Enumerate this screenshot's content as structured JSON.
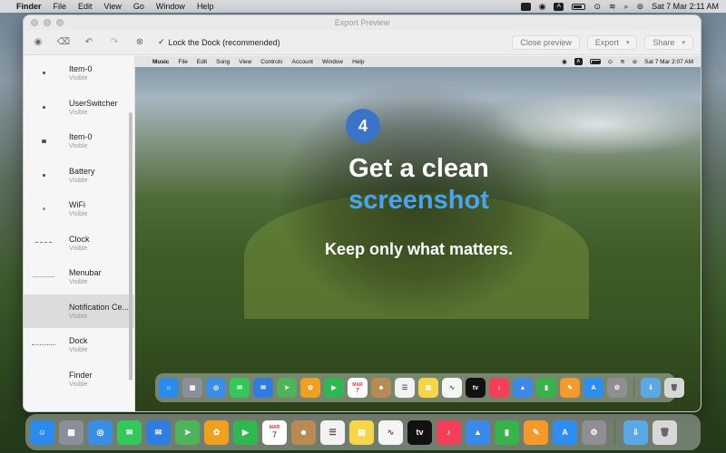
{
  "menubar": {
    "app_name": "Finder",
    "items": [
      "File",
      "Edit",
      "View",
      "Go",
      "Window",
      "Help"
    ],
    "clock": "Sat 7 Mar  2:11 AM",
    "status_a": "A"
  },
  "window": {
    "title": "Export Preview",
    "toolbar": {
      "checkbox_label": "Lock the Dock (recommended)",
      "close_preview": "Close preview",
      "export": "Export",
      "share": "Share"
    }
  },
  "sidebar": {
    "items": [
      {
        "name": "Item-0",
        "status": "Visible",
        "thumb": "dot"
      },
      {
        "name": "UserSwitcher",
        "status": "Visible",
        "thumb": "dot"
      },
      {
        "name": "Item-0",
        "status": "Visible",
        "thumb": "dot"
      },
      {
        "name": "Battery",
        "status": "Visible",
        "thumb": "dot"
      },
      {
        "name": "WiFi",
        "status": "Visible",
        "thumb": "dot"
      },
      {
        "name": "Clock",
        "status": "Visible",
        "thumb": "dash"
      },
      {
        "name": "Menubar",
        "status": "Visible",
        "thumb": "line"
      },
      {
        "name": "Notification Ce...",
        "status": "Visible",
        "thumb": "none",
        "selected": true
      },
      {
        "name": "Dock",
        "status": "Visible",
        "thumb": "dash"
      },
      {
        "name": "Finder",
        "status": "Visible",
        "thumb": "none"
      }
    ]
  },
  "preview": {
    "menubar": {
      "app_name": "Music",
      "items": [
        "File",
        "Edit",
        "Song",
        "View",
        "Controls",
        "Account",
        "Window",
        "Help"
      ],
      "clock": "Sat 7 Mar  2:07 AM",
      "status_a": "A"
    },
    "badge": "4",
    "headline_1": "Get a clean",
    "headline_2": "screenshot",
    "tagline": "Keep only what matters."
  },
  "dock": {
    "calendar_month": "MAR",
    "calendar_day": "7",
    "tv_label": "tv",
    "apps": [
      {
        "name": "Finder",
        "color": "#2a8bea",
        "glyph": "☺"
      },
      {
        "name": "Launchpad",
        "color": "#8a8f99",
        "glyph": "▦"
      },
      {
        "name": "Safari",
        "color": "#3a8ee6",
        "glyph": "◎"
      },
      {
        "name": "Messages",
        "color": "#34c759",
        "glyph": "✉"
      },
      {
        "name": "Mail",
        "color": "#2f7de1",
        "glyph": "✉"
      },
      {
        "name": "Maps",
        "color": "#4fb35a",
        "glyph": "➤"
      },
      {
        "name": "Photos",
        "color": "#f0a020",
        "glyph": "✿"
      },
      {
        "name": "FaceTime",
        "color": "#2fb84f",
        "glyph": "▶"
      },
      {
        "name": "Calendar",
        "color": "#ffffff",
        "glyph": "7"
      },
      {
        "name": "Contacts",
        "color": "#b88a55",
        "glyph": "☻"
      },
      {
        "name": "Reminders",
        "color": "#f2f2f2",
        "glyph": "☰"
      },
      {
        "name": "Notes",
        "color": "#f7d54a",
        "glyph": "▤"
      },
      {
        "name": "Freeform",
        "color": "#f5f5f5",
        "glyph": "∿"
      },
      {
        "name": "TV",
        "color": "#111111",
        "glyph": "tv"
      },
      {
        "name": "Music",
        "color": "#f2405b",
        "glyph": "♪"
      },
      {
        "name": "Keynote",
        "color": "#3b8ae8",
        "glyph": "▲"
      },
      {
        "name": "Numbers",
        "color": "#38b24a",
        "glyph": "▮"
      },
      {
        "name": "Pages",
        "color": "#f59a2a",
        "glyph": "✎"
      },
      {
        "name": "App Store",
        "color": "#2f8cf0",
        "glyph": "A"
      },
      {
        "name": "System Settings",
        "color": "#8e8e93",
        "glyph": "⚙"
      },
      {
        "name": "Downloads",
        "color": "#5aa9e6",
        "glyph": "⇩"
      },
      {
        "name": "Trash",
        "color": "#d7d7d7",
        "glyph": "🗑"
      }
    ]
  }
}
